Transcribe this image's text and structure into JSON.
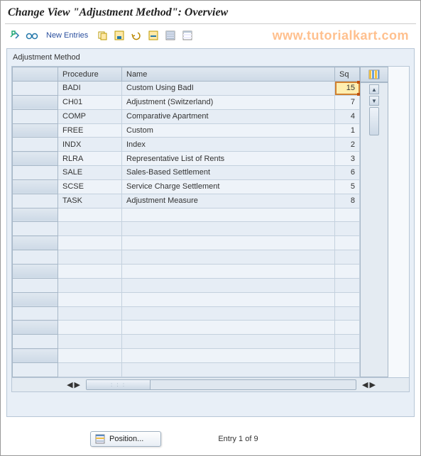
{
  "title": "Change View \"Adjustment Method\": Overview",
  "watermark": "www.tutorialkart.com",
  "toolbar": {
    "new_entries_label": "New Entries"
  },
  "group_label": "Adjustment Method",
  "columns": {
    "procedure": "Procedure",
    "name": "Name",
    "sq": "Sq"
  },
  "rows": [
    {
      "procedure": "BADI",
      "name": "Custom Using BadI",
      "sq": "15",
      "selected": true
    },
    {
      "procedure": "CH01",
      "name": "Adjustment (Switzerland)",
      "sq": "7"
    },
    {
      "procedure": "COMP",
      "name": "Comparative Apartment",
      "sq": "4"
    },
    {
      "procedure": "FREE",
      "name": "Custom",
      "sq": "1"
    },
    {
      "procedure": "INDX",
      "name": "Index",
      "sq": "2"
    },
    {
      "procedure": "RLRA",
      "name": "Representative List of Rents",
      "sq": "3"
    },
    {
      "procedure": "SALE",
      "name": "Sales-Based Settlement",
      "sq": "6"
    },
    {
      "procedure": "SCSE",
      "name": "Service Charge Settlement",
      "sq": "5"
    },
    {
      "procedure": "TASK",
      "name": "Adjustment Measure",
      "sq": "8"
    }
  ],
  "empty_rows": 12,
  "footer": {
    "position_label": "Position...",
    "status": "Entry 1 of 9"
  }
}
